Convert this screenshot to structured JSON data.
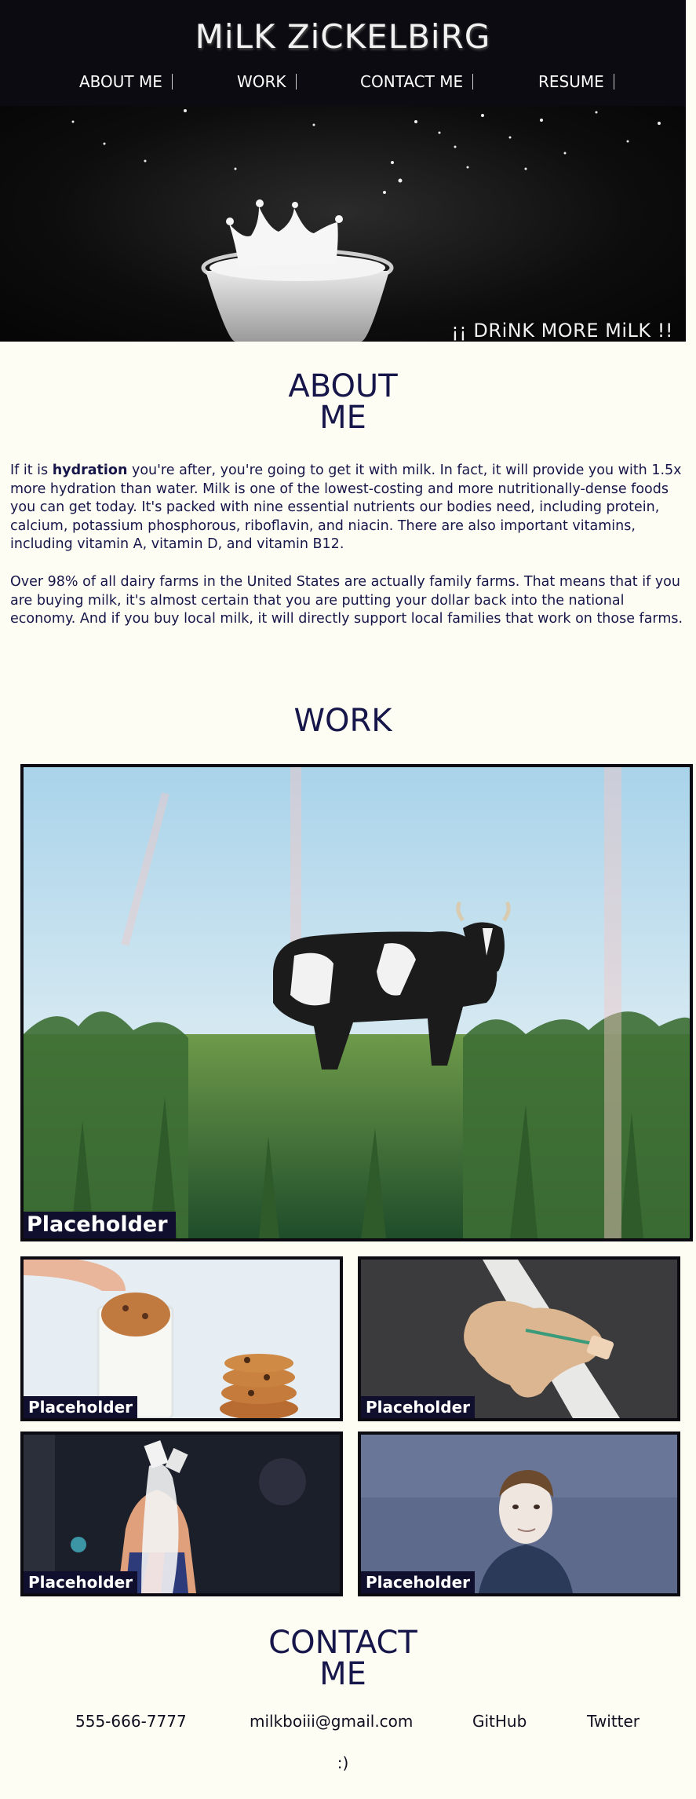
{
  "site": {
    "title": "MiLK ZiCKELBiRG"
  },
  "nav": {
    "items": [
      {
        "label": "ABOUT ME"
      },
      {
        "label": "WORK"
      },
      {
        "label": "CONTACT ME"
      },
      {
        "label": "RESUME"
      }
    ]
  },
  "hero": {
    "caption": "¡¡ DRiNK MORE MiLK !!"
  },
  "about": {
    "heading_line1": "ABOUT",
    "heading_line2": "ME",
    "p1_before": "If it is ",
    "p1_bold": "hydration",
    "p1_after": " you're after, you're going to get it with milk. In fact, it will provide you with 1.5x more hydration than water. Milk is one of the lowest-costing and more nutritionally-dense foods you can get today. It's packed with nine essential nutrients our bodies need, including protein, calcium, potassium phosphorous, riboflavin, and niacin. There are also important vitamins, including vitamin A, vitamin D, and vitamin B12.",
    "p2": "Over 98% of all dairy farms in the United States are actually family farms. That means that if you are buying milk, it's almost certain that you are putting your dollar back into the national economy. And if you buy local milk, it will directly support local families that work on those farms."
  },
  "work": {
    "heading": "WORK",
    "items": [
      {
        "label": "Placeholder",
        "subject": "cow-in-field"
      },
      {
        "label": "Placeholder",
        "subject": "cookie-in-milk"
      },
      {
        "label": "Placeholder",
        "subject": "spilled-milkshake"
      },
      {
        "label": "Placeholder",
        "subject": "man-pouring-milk"
      },
      {
        "label": "Placeholder",
        "subject": "milky-face-portrait"
      }
    ]
  },
  "contact": {
    "heading_line1": "CONTACT",
    "heading_line2": "ME",
    "phone": "555-666-7777",
    "email": "milkboiii@gmail.com",
    "github": "GitHub",
    "twitter": "Twitter",
    "smiley": ":)"
  },
  "colors": {
    "header_bg": "#0b0b11",
    "page_bg": "#fefdf3",
    "text": "#16164a",
    "label_bg": "#10102e"
  }
}
